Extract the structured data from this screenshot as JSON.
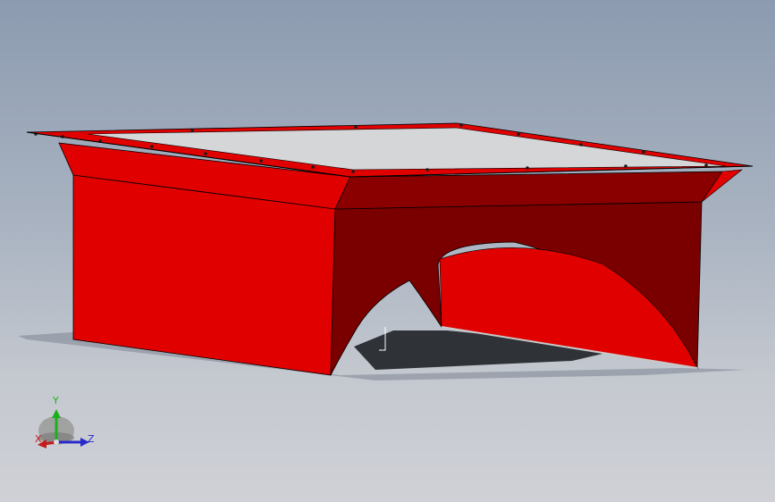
{
  "viewport": {
    "background_top": "#8c9bb0",
    "background_bottom": "#cfd1d6"
  },
  "model": {
    "body_color": "#e00000",
    "shade_color": "#7a0000",
    "top_panel_color": "#d4d6d8",
    "shadow_color": "#3a3d42"
  },
  "triad": {
    "y_label": "Y",
    "x_label": "X",
    "z_label": "Z",
    "y_color": "#1bb01b",
    "x_color": "#c41b1b",
    "z_color": "#2a2ac8"
  }
}
